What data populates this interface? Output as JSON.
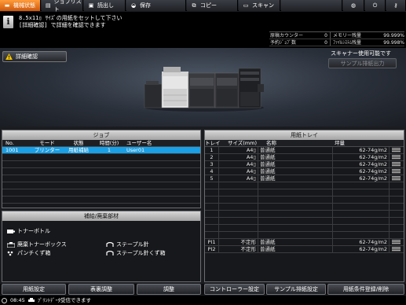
{
  "tabs": [
    {
      "label": "機械状態",
      "icon": "machine-icon"
    },
    {
      "label": "ジョブリスト",
      "icon": "job-list-icon"
    },
    {
      "label": "読出し",
      "icon": "read-icon"
    },
    {
      "label": "保存",
      "icon": "save-icon"
    },
    {
      "label": "コピー",
      "icon": "copy-icon"
    },
    {
      "label": "スキャン",
      "icon": "scan-icon"
    }
  ],
  "message": {
    "line1": "8.5x11▯ ｻｲｽﾞの用紙をセットして下さい",
    "line2": "[詳細確認] で詳細を確認できます"
  },
  "counters": {
    "rows": [
      {
        "label": "原稿カウンター",
        "value": "0",
        "label2": "メモリー残量",
        "value2": "99.999%"
      },
      {
        "label": "予約ｼﾞｮﾌﾞ数",
        "value": "0",
        "label2": "ﾌｧｲﾙｼｽﾃﾑ残量",
        "value2": "99.998%"
      }
    ]
  },
  "banner": {
    "detail_button": "詳細確認",
    "scanner_status": "スキャナー使用可能です",
    "sample_button": "サンプル排紙出力"
  },
  "job_panel": {
    "title": "ジョブ",
    "headers": [
      "No.",
      "モード",
      "状態",
      "時間(分)",
      "ユーザー名"
    ],
    "rows": [
      {
        "no": "1001",
        "mode": "プリンター",
        "status": "用紙補給",
        "time": "1",
        "user": "User01"
      }
    ],
    "empty_rows": 7
  },
  "supply_panel": {
    "title": "補給/廃棄部材",
    "items": {
      "toner_bottle": "トナーボトル",
      "waste_toner_box": "廃棄トナーボックス",
      "punch_waste": "パンチくず箱",
      "staple_needle": "ステープル針",
      "staple_waste": "ステープル針くず箱"
    }
  },
  "tray_panel": {
    "title": "用紙トレイ",
    "headers": [
      "トレイ",
      "サイズ(mm)",
      "名称",
      "坪量"
    ],
    "rows": [
      {
        "tray": "1",
        "size": "A4▯",
        "name": "普通紙",
        "weight": "62-74g/m2"
      },
      {
        "tray": "2",
        "size": "A4▯",
        "name": "普通紙",
        "weight": "62-74g/m2"
      },
      {
        "tray": "3",
        "size": "A4▯",
        "name": "普通紙",
        "weight": "62-74g/m2"
      },
      {
        "tray": "4",
        "size": "A4▯",
        "name": "普通紙",
        "weight": "62-74g/m2"
      },
      {
        "tray": "5",
        "size": "A4▯",
        "name": "普通紙",
        "weight": "62-74g/m2"
      }
    ],
    "pi_rows": [
      {
        "tray": "PI1",
        "size": "不定形",
        "name": "普通紙",
        "weight": "62-74g/m2"
      },
      {
        "tray": "PI2",
        "size": "不定形",
        "name": "普通紙",
        "weight": "62-74g/m2"
      }
    ]
  },
  "bottom_buttons": [
    "用紙設定",
    "表裏調整",
    "調整",
    "コントローラー設定",
    "サンプル排紙設定",
    "用紙条件登録/削除"
  ],
  "statusbar": {
    "time": "08:45",
    "message": "ﾌﾟﾘﾝﾄﾃﾞｰﾀ受信できます"
  },
  "colors": {
    "active_tab": "#f07a1a",
    "selected_row": "#1aa0e6",
    "warning": "#f2c300"
  }
}
